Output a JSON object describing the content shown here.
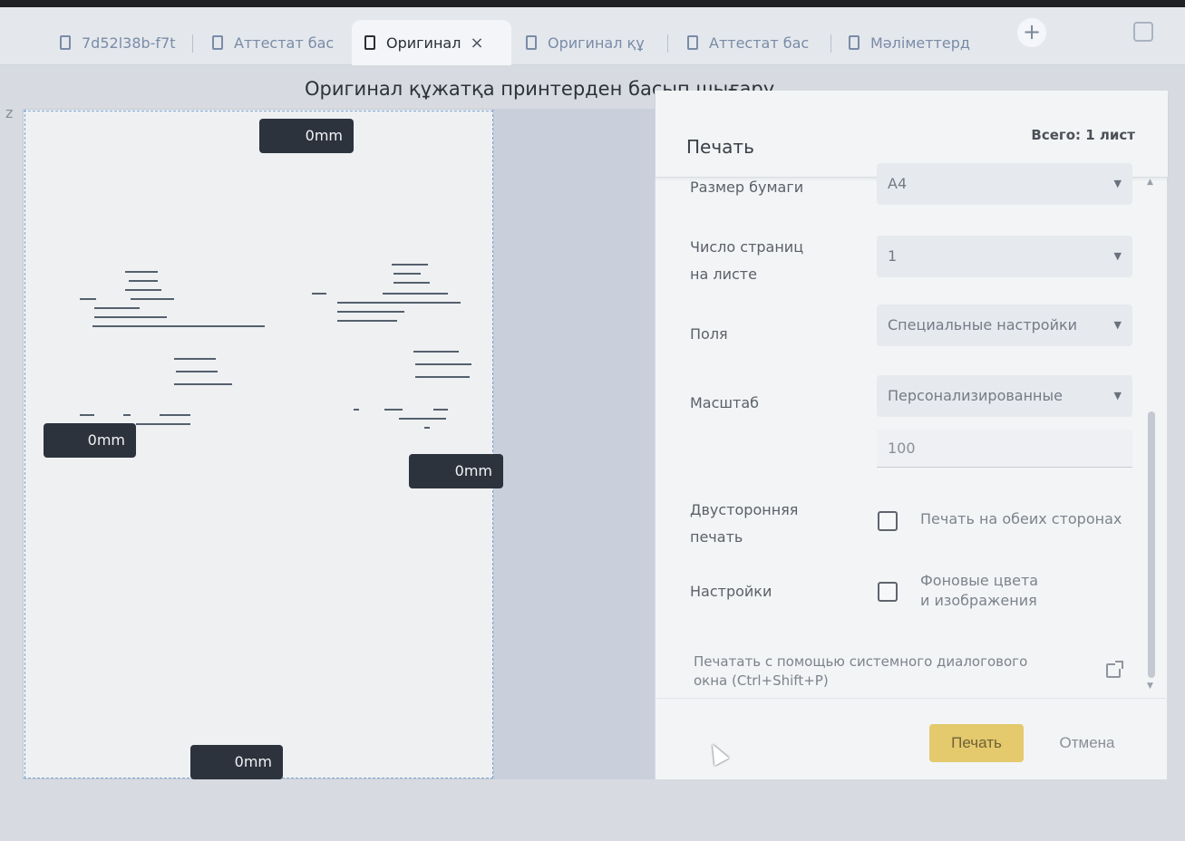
{
  "tabs": [
    {
      "label": "7d52l38b-f7t",
      "active": false
    },
    {
      "label": "Аттестат бас",
      "active": false
    },
    {
      "label": "Оригинал",
      "active": true
    },
    {
      "label": "Оригинал құ",
      "active": false
    },
    {
      "label": "Аттестат бас",
      "active": false
    },
    {
      "label": "Мәліметтерд",
      "active": false
    }
  ],
  "tab_close": "×",
  "new_tab": "+",
  "side_mark": "z",
  "page_title": "Оригинал құжатқа принтерден басып шығару",
  "preview": {
    "margin_top": "0mm",
    "margin_left": "0mm",
    "margin_right": "0mm",
    "margin_bottom": "0mm"
  },
  "print_panel": {
    "title": "Печать",
    "total": "Всего: 1 лист",
    "paper_size": {
      "label": "Размер бумаги",
      "value": "A4"
    },
    "pages_per_sheet": {
      "label_line1": "Число страниц",
      "label_line2": "на листе",
      "value": "1"
    },
    "margins": {
      "label": "Поля",
      "value": "Специальные настройки"
    },
    "scale": {
      "label": "Масштаб",
      "value": "Персонализированные",
      "custom_value": "100"
    },
    "duplex": {
      "label_line1": "Двусторонняя",
      "label_line2": "печать",
      "option": "Печать на обеих сторонах",
      "checked": false
    },
    "options": {
      "label": "Настройки",
      "option_line1": "Фоновые цвета",
      "option_line2": "и изображения",
      "checked": false
    },
    "system_dialog": {
      "line1": "Печатать с помощью системного диалогового",
      "line2": "окна (Ctrl+Shift+P)"
    },
    "print_button": "Печать",
    "cancel_button": "Отмена"
  },
  "colors": {
    "accent": "#e4c96d",
    "dark_tag": "#2c333d"
  }
}
